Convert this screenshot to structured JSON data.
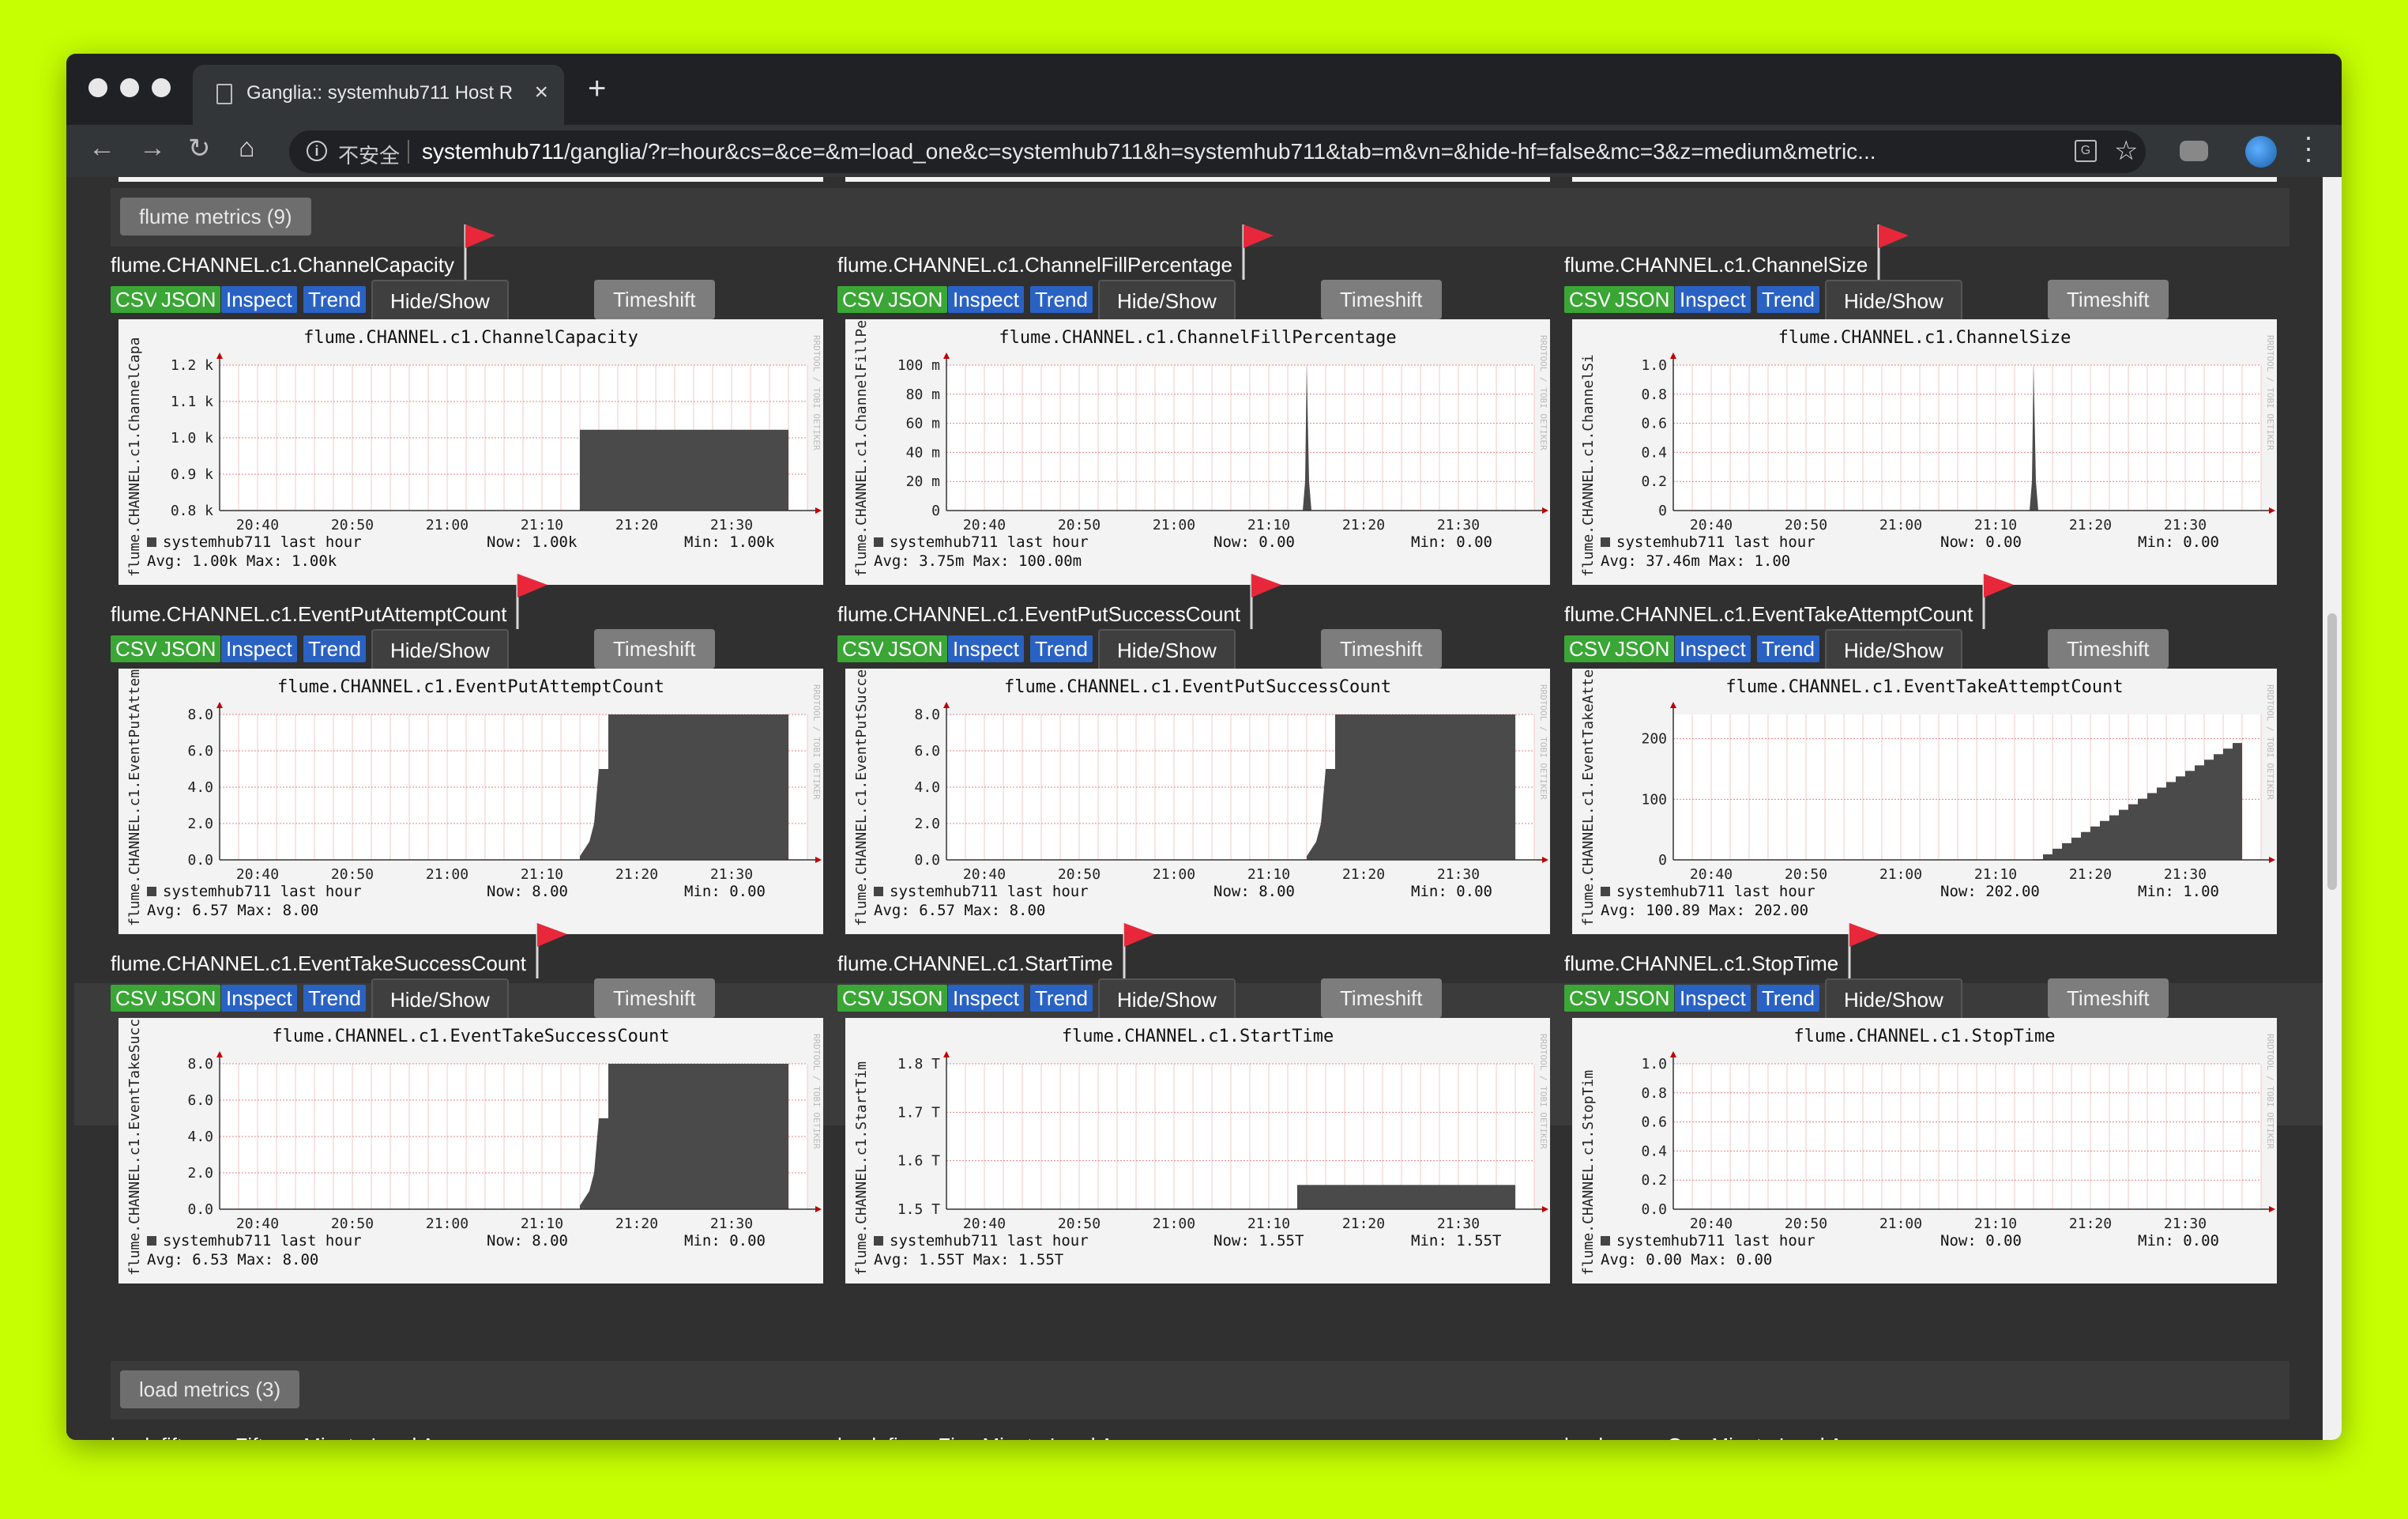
{
  "tab": {
    "title": "Ganglia:: systemhub711 Host R"
  },
  "address": {
    "security": "不安全",
    "host": "systemhub711",
    "path": "/ganglia/?r=hour&cs=&ce=&m=load_one&c=systemhub711&h=systemhub711&tab=m&vn=&hide-hf=false&mc=3&z=medium&metric..."
  },
  "buttons": {
    "csv": "CSV",
    "json": "JSON",
    "inspect": "Inspect",
    "trend": "Trend",
    "hide_show": "Hide/Show Events",
    "timeshift": "Timeshift"
  },
  "groups": [
    {
      "label": "flume metrics (9)"
    },
    {
      "label": "load metrics (3)"
    }
  ],
  "common_x_ticks": [
    "20:40",
    "20:50",
    "21:00",
    "21:10",
    "21:20",
    "21:30"
  ],
  "legend": {
    "host_label": "systemhub711 last hour",
    "now": "Now:",
    "min": "Min:",
    "avg": "Avg:",
    "max": "Max:"
  },
  "watermark": "RRDTOOL / TOBI OETIKER",
  "colors": {
    "flag": "#e8283a",
    "area": "#4a4a4a",
    "grid_minor": "#f0c8c8",
    "grid_major": "#e88080",
    "axis": "#c00000"
  },
  "metrics": [
    {
      "title": "flume.CHANNEL.c1.ChannelCapacity",
      "ylabel": "flume.CHANNEL.c1.ChannelCapa",
      "chart_data": {
        "type": "area",
        "x_ticks": [
          "20:40",
          "20:50",
          "21:00",
          "21:10",
          "21:20",
          "21:30"
        ],
        "y_ticks": [
          "1.2 k",
          "1.1 k",
          "1.0 k",
          "0.9 k",
          "0.8 k"
        ],
        "ylim": [
          750,
          1200
        ],
        "series": [
          {
            "x": [
              20.6,
              21.5,
              21.5,
              21.65,
              21.66
            ],
            "y": [
              null,
              null,
              1000,
              1000,
              null
            ]
          }
        ]
      },
      "legend": {
        "now": "1.00k",
        "min": "1.00k",
        "avg": "1.00k",
        "max": "1.00k"
      }
    },
    {
      "title": "flume.CHANNEL.c1.ChannelFillPercentage",
      "ylabel": "flume.CHANNEL.c1.ChannelFillPer",
      "chart_data": {
        "type": "area",
        "x_ticks": [
          "20:40",
          "20:50",
          "21:00",
          "21:10",
          "21:20",
          "21:30"
        ],
        "y_ticks": [
          "100 m",
          "80 m",
          "60 m",
          "40 m",
          "20 m",
          "0"
        ],
        "ylim": [
          0,
          100
        ],
        "series": [
          {
            "spike_at": "21:14",
            "peak": 100
          }
        ]
      },
      "legend": {
        "now": "0.00",
        "min": "0.00",
        "avg": "3.75m",
        "max": "100.00m"
      }
    },
    {
      "title": "flume.CHANNEL.c1.ChannelSize",
      "ylabel": "flume.CHANNEL.c1.ChannelSi",
      "chart_data": {
        "type": "area",
        "x_ticks": [
          "20:40",
          "20:50",
          "21:00",
          "21:10",
          "21:20",
          "21:30"
        ],
        "y_ticks": [
          "1.0",
          "0.8",
          "0.6",
          "0.4",
          "0.2",
          "0"
        ],
        "ylim": [
          0,
          1.0
        ],
        "series": [
          {
            "spike_at": "21:14",
            "peak": 1.0
          }
        ]
      },
      "legend": {
        "now": "0.00",
        "min": "0.00",
        "avg": "37.46m",
        "max": "1.00"
      }
    },
    {
      "title": "flume.CHANNEL.c1.EventPutAttemptCount",
      "ylabel": "flume.CHANNEL.c1.EventPutAttem",
      "chart_data": {
        "type": "area",
        "x_ticks": [
          "20:40",
          "20:50",
          "21:00",
          "21:10",
          "21:20",
          "21:30"
        ],
        "y_ticks": [
          "8.0",
          "6.0",
          "4.0",
          "2.0",
          "0.0"
        ],
        "ylim": [
          0,
          8.0
        ],
        "series": [
          {
            "steps": [
              [
                "21:14",
                0.2
              ],
              [
                "21:15",
                1.0
              ],
              [
                "21:15",
                2.0
              ],
              [
                "21:15",
                4.0
              ],
              [
                "21:16",
                5.0
              ],
              [
                "21:17",
                5.0
              ],
              [
                "21:17",
                8.0
              ],
              [
                "21:36",
                8.0
              ]
            ]
          }
        ]
      },
      "legend": {
        "now": "8.00",
        "min": "0.00",
        "avg": "6.57",
        "max": "8.00"
      }
    },
    {
      "title": "flume.CHANNEL.c1.EventPutSuccessCount",
      "ylabel": "flume.CHANNEL.c1.EventPutSucce",
      "chart_data": {
        "type": "area",
        "x_ticks": [
          "20:40",
          "20:50",
          "21:00",
          "21:10",
          "21:20",
          "21:30"
        ],
        "y_ticks": [
          "8.0",
          "6.0",
          "4.0",
          "2.0",
          "0.0"
        ],
        "ylim": [
          0,
          8.0
        ],
        "series": [
          {
            "steps": [
              [
                "21:14",
                0.2
              ],
              [
                "21:15",
                1.0
              ],
              [
                "21:15",
                2.0
              ],
              [
                "21:15",
                4.0
              ],
              [
                "21:16",
                5.0
              ],
              [
                "21:17",
                5.0
              ],
              [
                "21:17",
                8.0
              ],
              [
                "21:36",
                8.0
              ]
            ]
          }
        ]
      },
      "legend": {
        "now": "8.00",
        "min": "0.00",
        "avg": "6.57",
        "max": "8.00"
      }
    },
    {
      "title": "flume.CHANNEL.c1.EventTakeAttemptCount",
      "ylabel": "flume.CHANNEL.c1.EventTakeAttempt",
      "chart_data": {
        "type": "area",
        "x_ticks": [
          "20:40",
          "20:50",
          "21:00",
          "21:10",
          "21:20",
          "21:30"
        ],
        "y_ticks": [
          "200",
          "100",
          "0"
        ],
        "ylim": [
          0,
          240
        ],
        "series": [
          {
            "ramp_from": "21:14",
            "ramp_to": "21:36",
            "start": 0,
            "end": 202
          }
        ]
      },
      "legend": {
        "now": "202.00",
        "min": "1.00",
        "avg": "100.89",
        "max": "202.00"
      }
    },
    {
      "title": "flume.CHANNEL.c1.EventTakeSuccessCount",
      "ylabel": "flume.CHANNEL.c1.EventTakeSucce",
      "chart_data": {
        "type": "area",
        "x_ticks": [
          "20:40",
          "20:50",
          "21:00",
          "21:10",
          "21:20",
          "21:30"
        ],
        "y_ticks": [
          "8.0",
          "6.0",
          "4.0",
          "2.0",
          "0.0"
        ],
        "ylim": [
          0,
          8.0
        ],
        "series": [
          {
            "steps": [
              [
                "21:14",
                0.2
              ],
              [
                "21:15",
                1.0
              ],
              [
                "21:15",
                2.0
              ],
              [
                "21:15",
                4.0
              ],
              [
                "21:16",
                5.0
              ],
              [
                "21:17",
                5.0
              ],
              [
                "21:17",
                8.0
              ],
              [
                "21:36",
                8.0
              ]
            ]
          }
        ]
      },
      "legend": {
        "now": "8.00",
        "min": "0.00",
        "avg": "6.53",
        "max": "8.00"
      }
    },
    {
      "title": "flume.CHANNEL.c1.StartTime",
      "ylabel": "flume.CHANNEL.c1.StartTim",
      "chart_data": {
        "type": "area",
        "x_ticks": [
          "20:40",
          "20:50",
          "21:00",
          "21:10",
          "21:20",
          "21:30"
        ],
        "y_ticks": [
          "1.8 T",
          "1.7 T",
          "1.6 T",
          "1.5 T"
        ],
        "ylim": [
          1.5,
          1.8
        ],
        "series": [
          {
            "from": "21:13",
            "to": "21:36",
            "value": 1.55
          }
        ]
      },
      "legend": {
        "now": "1.55T",
        "min": "1.55T",
        "avg": "1.55T",
        "max": "1.55T"
      }
    },
    {
      "title": "flume.CHANNEL.c1.StopTime",
      "ylabel": "flume.CHANNEL.c1.StopTim",
      "chart_data": {
        "type": "area",
        "x_ticks": [
          "20:40",
          "20:50",
          "21:00",
          "21:10",
          "21:20",
          "21:30"
        ],
        "y_ticks": [
          "1.0",
          "0.8",
          "0.6",
          "0.4",
          "0.2",
          "0.0"
        ],
        "ylim": [
          0,
          1.0
        ],
        "series": []
      },
      "legend": {
        "now": "0.00",
        "min": "0.00",
        "avg": "0.00",
        "max": "0.00"
      }
    }
  ],
  "load_metrics": [
    {
      "title": "load_fifteen - Fifteen Minute Load Average"
    },
    {
      "title": "load_five - Five Minute Load Average"
    },
    {
      "title": "load_one - One Minute Load Average"
    }
  ]
}
